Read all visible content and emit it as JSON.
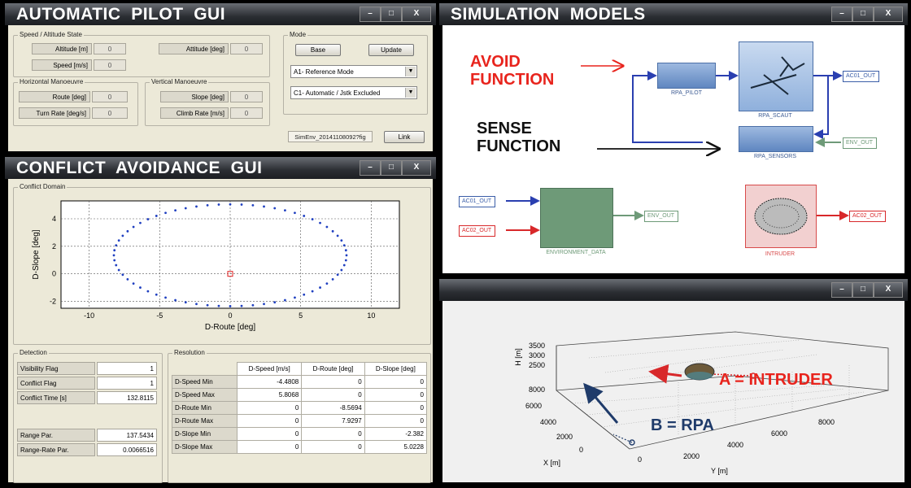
{
  "window_buttons": {
    "minimize": "–",
    "maximize": "□",
    "close": "X"
  },
  "pilot": {
    "title": "AUTOMATIC  PILOT  GUI",
    "speed_alt": {
      "label": "Speed / Altitude State",
      "altitude_m": {
        "label": "Altitude [m]",
        "value": "0"
      },
      "attitude_deg": {
        "label": "Attitude [deg]",
        "value": "0"
      },
      "speed_ms": {
        "label": "Speed [m/s]",
        "value": "0"
      }
    },
    "mode": {
      "label": "Mode",
      "base_btn": "Base",
      "update_btn": "Update",
      "mode_select": "A1- Reference Mode",
      "control_select": "C1- Automatic / Jstk Excluded"
    },
    "horizontal": {
      "label": "Horizontal Manoeuvre",
      "route_deg": {
        "label": "Route [deg]",
        "value": "0"
      },
      "turn_rate": {
        "label": "Turn Rate [deg/s]",
        "value": "0"
      }
    },
    "vertical": {
      "label": "Vertical Manoeuvre",
      "slope_deg": {
        "label": "Slope [deg]",
        "value": "0"
      },
      "climb_rate": {
        "label": "Climb Rate [m/s]",
        "value": "0"
      }
    },
    "simenv": "SimEnv_20141108092?fig",
    "link_btn": "Link"
  },
  "conflict": {
    "title": "CONFLICT  AVOIDANCE  GUI",
    "domain_label": "Conflict Domain",
    "xlabel": "D-Route [deg]",
    "ylabel": "D-Slope [deg]",
    "detection": {
      "label": "Detection",
      "rows": [
        {
          "key": "Visibility Flag",
          "value": "1"
        },
        {
          "key": "Conflict Flag",
          "value": "1"
        },
        {
          "key": "Conflict Time [s]",
          "value": "132.8115"
        },
        {
          "key": "Range Par.",
          "value": "137.5434"
        },
        {
          "key": "Range-Rate Par.",
          "value": "0.0066516"
        }
      ]
    },
    "resolution": {
      "label": "Resolution",
      "headers": [
        "D-Speed [m/s]",
        "D-Route [deg]",
        "D-Slope [deg]"
      ],
      "rows": [
        {
          "key": "D-Speed Min",
          "values": [
            "-4.4808",
            "0",
            "0"
          ]
        },
        {
          "key": "D-Speed Max",
          "values": [
            "5.8068",
            "0",
            "0"
          ]
        },
        {
          "key": "D-Route Min",
          "values": [
            "0",
            "-8.5694",
            "0"
          ]
        },
        {
          "key": "D-Route Max",
          "values": [
            "0",
            "7.9297",
            "0"
          ]
        },
        {
          "key": "D-Slope Min",
          "values": [
            "0",
            "0",
            "-2.382"
          ]
        },
        {
          "key": "D-Slope Max",
          "values": [
            "0",
            "0",
            "5.0228"
          ]
        }
      ]
    }
  },
  "chart_data": {
    "type": "scatter",
    "xlabel": "D-Route [deg]",
    "ylabel": "D-Slope [deg]",
    "xlim": [
      -12,
      12
    ],
    "ylim": [
      -2.5,
      5.3
    ],
    "xticks": [
      -10,
      -5,
      0,
      5,
      10
    ],
    "yticks": [
      -2,
      0,
      2,
      4
    ],
    "grid": true,
    "ellipse": {
      "center_x": 0,
      "center_y": 1.35,
      "radius_x": 8.25,
      "radius_y": 3.7,
      "points": 64
    },
    "center_marker": {
      "x": 0,
      "y": 0
    }
  },
  "simulation": {
    "title": "SIMULATION  MODELS",
    "avoid": "AVOID\nFUNCTION",
    "sense": "SENSE\nFUNCTION",
    "blocks": {
      "pilot": "RPA_PILOT",
      "scaut": "RPA_SCAUT",
      "sensors": "RPA_SENSORS",
      "env": "ENVIRONMENT_DATA",
      "intruder": "INTRUDER"
    },
    "ports": {
      "ac01_out": "AC01_OUT",
      "env_out": "ENV_OUT",
      "ac02_out": "AC02_OUT"
    },
    "colors": {
      "avoid": "#e8241d",
      "sense": "#111111",
      "env": "#6e9a78",
      "intruder": "#e05a5a"
    }
  },
  "plot3d": {
    "zlabel": "H [m]",
    "xlabel": "X [m]",
    "ylabel": "Y [m]",
    "zticks": [
      "3500",
      "3000",
      "2500"
    ],
    "xticks": [
      "8000",
      "6000",
      "4000",
      "2000",
      "0"
    ],
    "yticks": [
      "0",
      "2000",
      "4000",
      "6000",
      "8000"
    ],
    "intruder_label": "A = INTRUDER",
    "rpa_label": "B = RPA"
  }
}
